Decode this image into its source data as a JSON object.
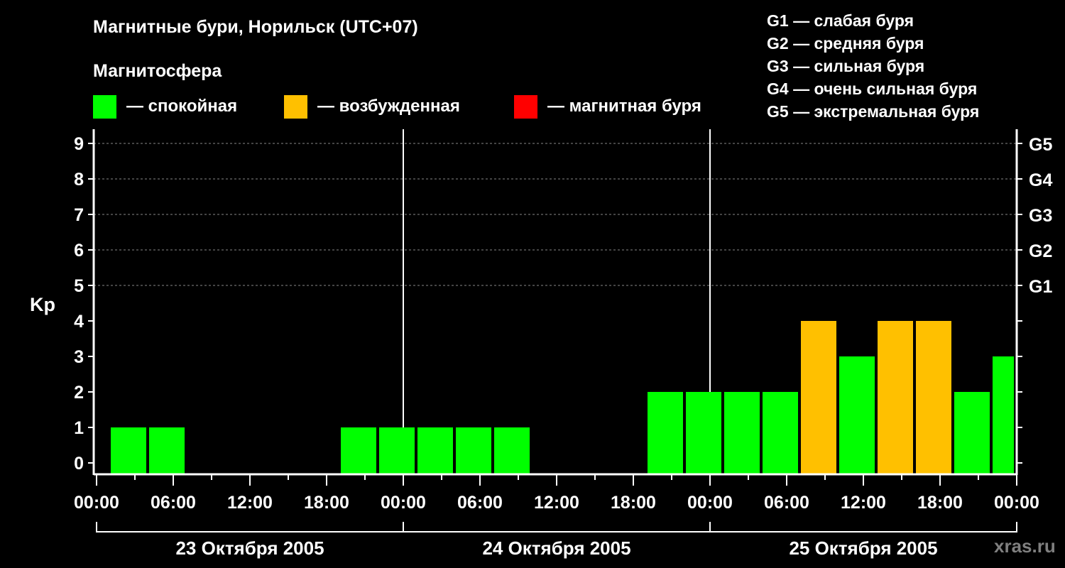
{
  "title": "Магнитные бури, Норильск (UTC+07)",
  "legend": {
    "heading": "Магнитосфера",
    "items": [
      {
        "label": "— спокойная",
        "color": "#00ff00"
      },
      {
        "label": "— возбужденная",
        "color": "#ffc000"
      },
      {
        "label": "— магнитная буря",
        "color": "#ff0000"
      }
    ]
  },
  "g_scale": [
    "G1 — слабая буря",
    "G2 — средняя буря",
    "G3 — сильная буря",
    "G4 — очень сильная буря",
    "G5 — экстремальная буря"
  ],
  "watermark": "xras.ru",
  "chart_data": {
    "type": "bar",
    "ylabel": "Kp",
    "ylim": [
      0,
      9
    ],
    "yticks": [
      "0",
      "1",
      "2",
      "3",
      "4",
      "5",
      "6",
      "7",
      "8",
      "9"
    ],
    "right_ticks": [
      {
        "kp": 5,
        "label": "G1"
      },
      {
        "kp": 6,
        "label": "G2"
      },
      {
        "kp": 7,
        "label": "G3"
      },
      {
        "kp": 8,
        "label": "G4"
      },
      {
        "kp": 9,
        "label": "G5"
      }
    ],
    "xticks": [
      "00:00",
      "06:00",
      "12:00",
      "18:00",
      "00:00",
      "06:00",
      "12:00",
      "18:00",
      "00:00",
      "06:00",
      "12:00",
      "18:00",
      "00:00"
    ],
    "days": [
      "23 Октября 2005",
      "24 Октября 2005",
      "25 Октября 2005"
    ],
    "interval_hours": 3,
    "first_interval_start_hour": 1,
    "values": [
      1,
      1,
      0,
      0,
      0,
      0,
      1,
      1,
      1,
      1,
      1,
      0,
      0,
      0,
      2,
      2,
      2,
      2,
      4,
      3,
      4,
      4,
      2,
      3
    ],
    "grid": true
  }
}
